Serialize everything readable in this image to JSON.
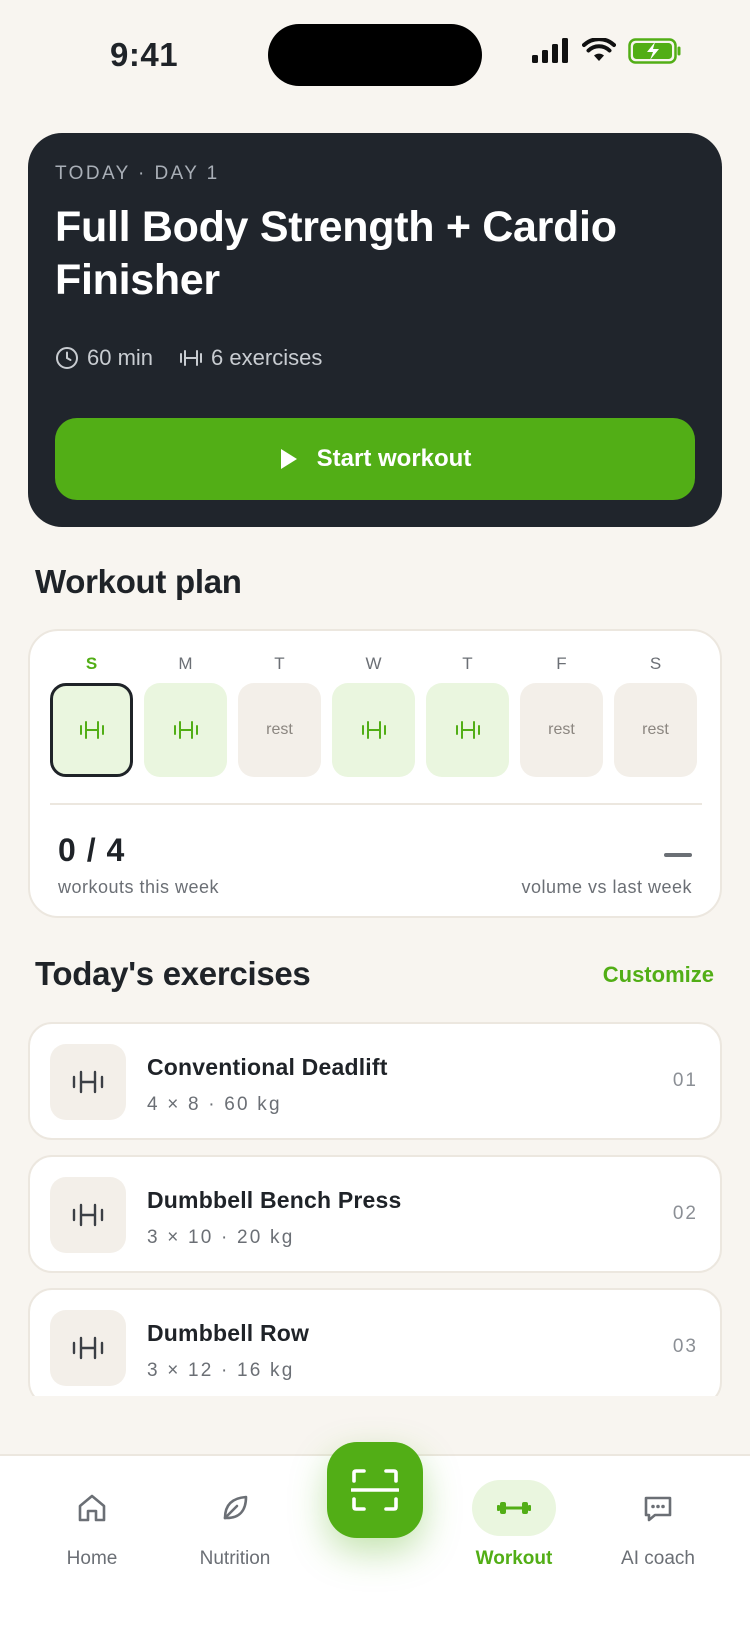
{
  "status_bar": {
    "time": "9:41"
  },
  "hero": {
    "eyebrow": "TODAY · DAY 1",
    "title": "Full Body Strength + Cardio Finisher",
    "duration": "60 min",
    "exercise_count": "6 exercises",
    "start_label": "Start workout"
  },
  "plan": {
    "title": "Workout plan",
    "days": [
      {
        "letter": "S",
        "type": "train",
        "label": ""
      },
      {
        "letter": "M",
        "type": "train",
        "label": ""
      },
      {
        "letter": "T",
        "type": "rest",
        "label": "rest"
      },
      {
        "letter": "W",
        "type": "train",
        "label": ""
      },
      {
        "letter": "T",
        "type": "train",
        "label": ""
      },
      {
        "letter": "F",
        "type": "rest",
        "label": "rest"
      },
      {
        "letter": "S",
        "type": "rest",
        "label": "rest"
      }
    ],
    "today_index": 0,
    "count": "0 / 4",
    "count_label": "workouts this week",
    "volume_label": "volume vs last week"
  },
  "exercises": {
    "title": "Today's exercises",
    "customize_label": "Customize",
    "items": [
      {
        "name": "Conventional Deadlift",
        "sets": "4 × 8 · 60 kg",
        "num": "01"
      },
      {
        "name": "Dumbbell Bench Press",
        "sets": "3 × 10 · 20 kg",
        "num": "02"
      },
      {
        "name": "Dumbbell Row",
        "sets": "3 × 12 · 16 kg",
        "num": "03"
      }
    ]
  },
  "nav": {
    "home": "Home",
    "nutrition": "Nutrition",
    "workout": "Workout",
    "coach": "AI coach"
  },
  "colors": {
    "accent": "#52ae16",
    "hero_bg": "#20252c",
    "background": "#f8f5f0"
  }
}
